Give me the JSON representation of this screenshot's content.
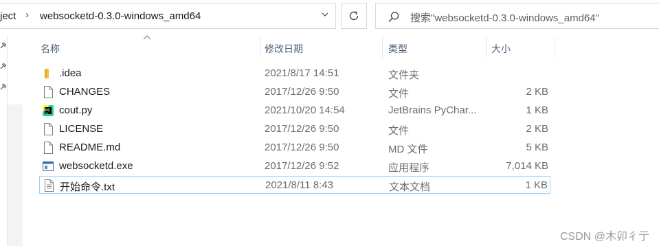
{
  "address": {
    "prev_crumb": "ject",
    "current_crumb": "websocketd-0.3.0-windows_amd64"
  },
  "search": {
    "placeholder": "搜索\"websocketd-0.3.0-windows_amd64\""
  },
  "columns": {
    "name": "名称",
    "date": "修改日期",
    "type": "类型",
    "size": "大小"
  },
  "files": [
    {
      "name": ".idea",
      "date": "2021/8/17 14:51",
      "type": "文件夹",
      "size": "",
      "icon": "folder-icon"
    },
    {
      "name": "CHANGES",
      "date": "2017/12/26 9:50",
      "type": "文件",
      "size": "2 KB",
      "icon": "file-icon"
    },
    {
      "name": "cout.py",
      "date": "2021/10/20 14:54",
      "type": "JetBrains PyChar...",
      "size": "1 KB",
      "icon": "pycharm-icon"
    },
    {
      "name": "LICENSE",
      "date": "2017/12/26 9:50",
      "type": "文件",
      "size": "2 KB",
      "icon": "file-icon"
    },
    {
      "name": "README.md",
      "date": "2017/12/26 9:50",
      "type": "MD 文件",
      "size": "5 KB",
      "icon": "file-icon"
    },
    {
      "name": "websocketd.exe",
      "date": "2017/12/26 9:52",
      "type": "应用程序",
      "size": "7,014 KB",
      "icon": "exe-icon"
    },
    {
      "name": "开始命令.txt",
      "date": "2021/8/11 8:43",
      "type": "文本文档",
      "size": "1 KB",
      "icon": "text-file-icon"
    }
  ],
  "watermark": "CSDN @木卯彳亍"
}
